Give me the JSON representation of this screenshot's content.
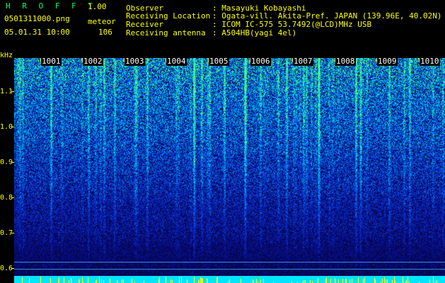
{
  "header": {
    "brand": "H R O F F T",
    "version": "1.00",
    "filename": "0501311000.png",
    "meteor_label": "meteor",
    "datetime": "05.01.31 10:00",
    "meteor_count": "106"
  },
  "meta": [
    {
      "key": "Observer",
      "value": ": Masayuki Kobayashi"
    },
    {
      "key": "Receiving Location",
      "value": ": Ogata-vill. Akita-Pref. JAPAN (139.96E, 40.02N)"
    },
    {
      "key": "Receiver",
      "value": ": ICOM IC-575 53.7492(@LCD)MHz USB"
    },
    {
      "key": "Receiving antenna",
      "value": ": A504HB(yagi 4el)"
    }
  ],
  "y_axis": {
    "unit": "kHz",
    "ticks": [
      "1.1",
      "1.0",
      "0.9",
      "0.8",
      "0.7",
      "0.6"
    ]
  },
  "minute_markers": [
    "1001",
    "1002",
    "1003",
    "1004",
    "1005",
    "1006",
    "1007",
    "1008",
    "1009",
    "1010"
  ],
  "colors": {
    "background": "#000000",
    "text": "#ffff00",
    "brand": "#00ff66",
    "strip": "#00e5ff"
  }
}
